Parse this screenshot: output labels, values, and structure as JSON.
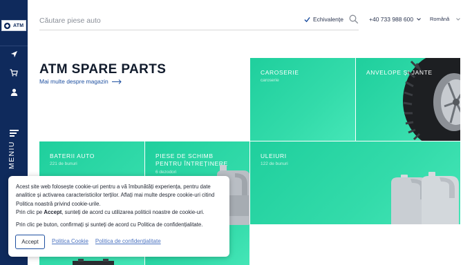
{
  "sidebar": {
    "logo_text": "ATM",
    "menu_label": "MENIU"
  },
  "header": {
    "search_placeholder": "Căutare piese auto",
    "equivalents_label": "Echivalențe",
    "equivalents_checked": true,
    "phone": "+40 733 988 600",
    "language": "Română"
  },
  "hero": {
    "title": "ATM SPARE PARTS",
    "more_link": "Mai multe despre magazin"
  },
  "tiles": [
    {
      "title": "CAROSERIE",
      "subtitle": "caroserie"
    },
    {
      "title": "ANVELOPE ȘI JANTE",
      "subtitle": ""
    },
    {
      "title": "BATERII AUTO",
      "subtitle": "221 de bunuri"
    },
    {
      "title": "PIESE DE SCHIMB PENTRU ÎNTREȚINERE",
      "subtitle": "6 dezodori"
    },
    {
      "title": "ULEIURI",
      "subtitle": "122 de bunuri"
    }
  ],
  "cookie": {
    "text1": "Acest site web folosește cookie-uri pentru a vă îmbunătăți experiența, pentru date analitice și activarea caracteristicilor terților. Aflați mai multe despre cookie-uri citind Politica noastră privind cookie-urile.",
    "text2_pre": "Prin clic pe ",
    "text2_bold": "Accept",
    "text2_post": ", sunteți de acord cu utilizarea politicii noastre de cookie-uri.",
    "text3": "Prin clic pe buton, confirmați și sunteți de acord cu Politica de confidențialitate.",
    "accept_label": "Accept",
    "cookie_policy_link": "Politica Cookie",
    "privacy_link": "Politica de confidențialitate"
  },
  "colors": {
    "sidebar": "#0f2a5c",
    "tile": "#33dbaa",
    "accent": "#1d4fa0"
  }
}
